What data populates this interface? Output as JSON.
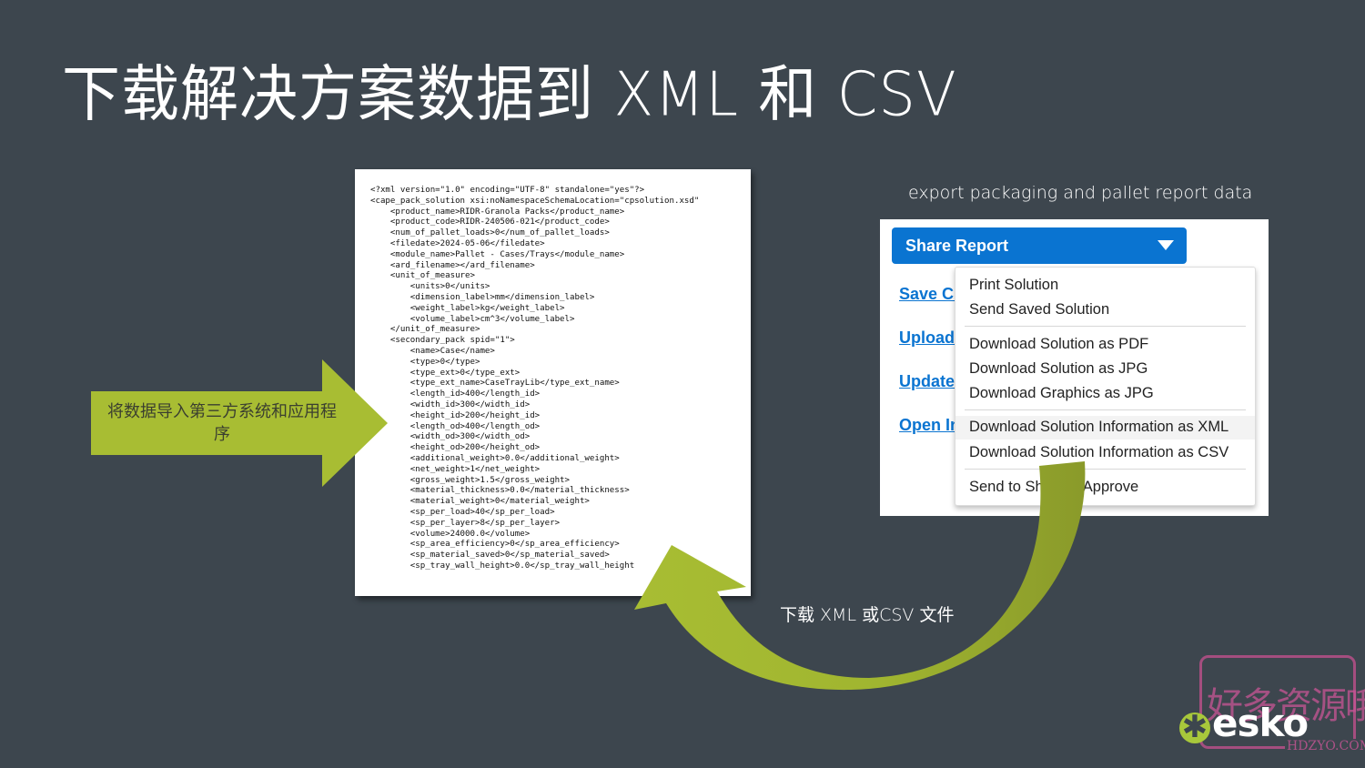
{
  "slide": {
    "title": "下载解决方案数据到 XML 和 CSV",
    "left_arrow_text": "将数据导入第三方系统和应用程序",
    "export_caption": "export packaging and pallet report data",
    "curve_caption": "下载 XML 或CSV 文件",
    "accent_color": "#a8bd33",
    "background_color": "#3d464e"
  },
  "xml_doc": {
    "lines": [
      "<?xml version=\"1.0\" encoding=\"UTF-8\" standalone=\"yes\"?>",
      "<cape_pack_solution xsi:noNamespaceSchemaLocation=\"cpsolution.xsd\"",
      "    <product_name>RIDR-Granola Packs</product_name>",
      "    <product_code>RIDR-240506-021</product_code>",
      "    <num_of_pallet_loads>0</num_of_pallet_loads>",
      "    <filedate>2024-05-06</filedate>",
      "    <module_name>Pallet - Cases/Trays</module_name>",
      "    <ard_filename></ard_filename>",
      "    <unit_of_measure>",
      "        <units>0</units>",
      "        <dimension_label>mm</dimension_label>",
      "        <weight_label>kg</weight_label>",
      "        <volume_label>cm^3</volume_label>",
      "    </unit_of_measure>",
      "    <secondary_pack spid=\"1\">",
      "        <name>Case</name>",
      "        <type>0</type>",
      "        <type_ext>0</type_ext>",
      "        <type_ext_name>CaseTrayLib</type_ext_name>",
      "        <length_id>400</length_id>",
      "        <width_id>300</width_id>",
      "        <height_id>200</height_id>",
      "        <length_od>400</length_od>",
      "        <width_od>300</width_od>",
      "        <height_od>200</height_od>",
      "        <additional_weight>0.0</additional_weight>",
      "        <net_weight>1</net_weight>",
      "        <gross_weight>1.5</gross_weight>",
      "        <material_thickness>0.0</material_thickness>",
      "        <material_weight>0</material_weight>",
      "        <sp_per_load>40</sp_per_load>",
      "        <sp_per_layer>8</sp_per_layer>",
      "        <volume>24000.0</volume>",
      "        <sp_area_efficiency>0</sp_area_efficiency>",
      "        <sp_material_saved>0</sp_material_saved>",
      "        <sp_tray_wall_height>0.0</sp_tray_wall_height"
    ]
  },
  "share_panel": {
    "button_label": "Share Report",
    "button_color": "#0a74d1",
    "links": [
      "Save Cr",
      "Upload",
      "Update",
      "Open In"
    ],
    "menu_groups": [
      [
        "Print Solution",
        "Send Saved Solution"
      ],
      [
        "Download Solution as PDF",
        "Download Solution as JPG",
        "Download Graphics as JPG"
      ],
      [
        "Download Solution Information as XML",
        "Download Solution Information as CSV"
      ],
      [
        "Send to Share & Approve"
      ]
    ],
    "highlighted_item": "Download Solution Information as XML"
  },
  "logo": {
    "text": "esko",
    "mark": "✱"
  },
  "watermark": {
    "text": "好多资源哦",
    "url": "HDZYO.COM"
  }
}
